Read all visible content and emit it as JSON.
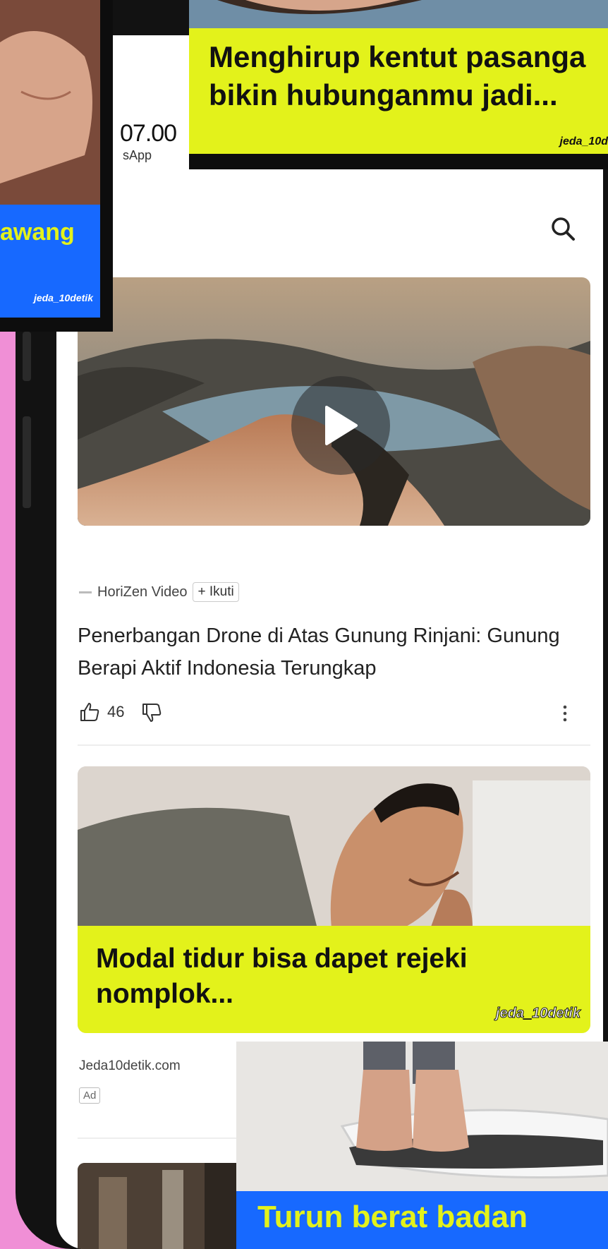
{
  "status": {
    "time_fragment": "07.00",
    "app_fragment": "sApp"
  },
  "video_card": {
    "source_name": "HoriZen Video",
    "follow_label": "+ Ikuti",
    "headline": "Penerbangan Drone di Atas Gunung Rinjani: Gunung Berapi Aktif Indonesia Terungkap",
    "like_count": "46"
  },
  "ad_card": {
    "title": "Modal tidur bisa dapet rejeki nomplok...",
    "brand": "jeda_10detik",
    "source": "Jeda10detik.com",
    "ad_label": "Ad"
  },
  "overlay_left": {
    "title_fragment": "awang",
    "brand": "jeda_10detik"
  },
  "overlay_top": {
    "title": "Menghirup kentut pasanga bikin hubunganmu jadi...",
    "title_line1": "Menghirup kentut pasanga",
    "title_line2": "bikin hubunganmu jadi...",
    "brand": "jeda_10d"
  },
  "overlay_bottom": {
    "title": "Turun berat badan"
  },
  "colors": {
    "accent_yellow": "#e3f21b",
    "accent_blue": "#1769ff",
    "background_pink": "#f08fd6"
  }
}
